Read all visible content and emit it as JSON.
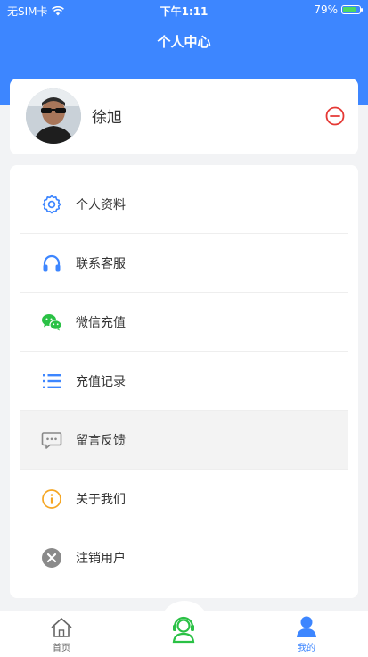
{
  "statusbar": {
    "carrier": "无SIM卡",
    "time": "下午1:11",
    "battery": "79%"
  },
  "header": {
    "title": "个人中心"
  },
  "profile": {
    "name": "徐旭"
  },
  "menu": [
    {
      "label": "个人资料",
      "icon": "settings-icon"
    },
    {
      "label": "联系客服",
      "icon": "headphones-icon"
    },
    {
      "label": "微信充值",
      "icon": "wechat-icon"
    },
    {
      "label": "充值记录",
      "icon": "list-icon"
    },
    {
      "label": "留言反馈",
      "icon": "message-icon"
    },
    {
      "label": "关于我们",
      "icon": "info-icon"
    },
    {
      "label": "注销用户",
      "icon": "close-circle-icon"
    }
  ],
  "tabbar": {
    "home_label": "首页",
    "center_icon": "service-agent-icon",
    "mine_label": "我的"
  },
  "colors": {
    "primary": "#3d86ff",
    "danger": "#e53935",
    "wechat": "#2ac145",
    "warning": "#f5a623"
  }
}
